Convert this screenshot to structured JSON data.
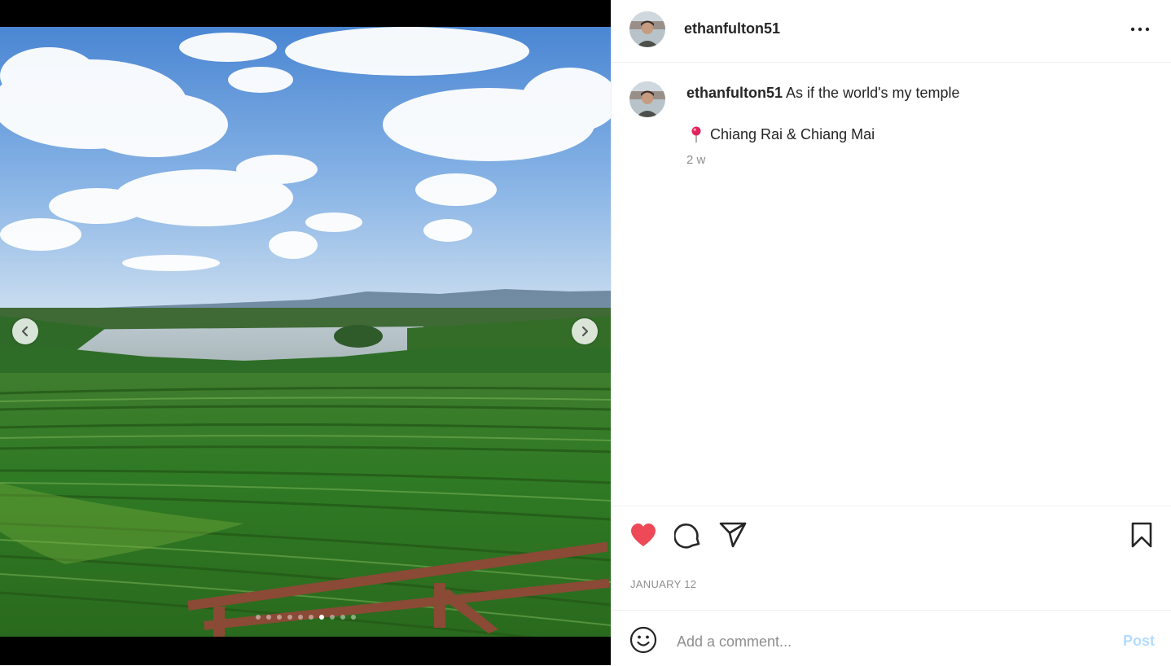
{
  "header": {
    "username": "ethanfulton51"
  },
  "caption": {
    "username": "ethanfulton51",
    "text": "As if the world's my temple",
    "location_pin": "📍",
    "location": "Chiang Rai & Chiang Mai",
    "time_ago": "2 w"
  },
  "post": {
    "date": "JANUARY 12",
    "liked": true,
    "like_color": "#ed4956"
  },
  "carousel": {
    "total_images": 10,
    "current_index": 6
  },
  "comment": {
    "placeholder": "Add a comment...",
    "post_label": "Post",
    "post_color": "#b3dbff"
  },
  "icons": {
    "more": "more-options-icon",
    "like": "heart-icon",
    "comment": "comment-icon",
    "share": "share-icon",
    "save": "bookmark-icon",
    "emoji": "emoji-icon",
    "prev": "chevron-left-icon",
    "next": "chevron-right-icon"
  }
}
